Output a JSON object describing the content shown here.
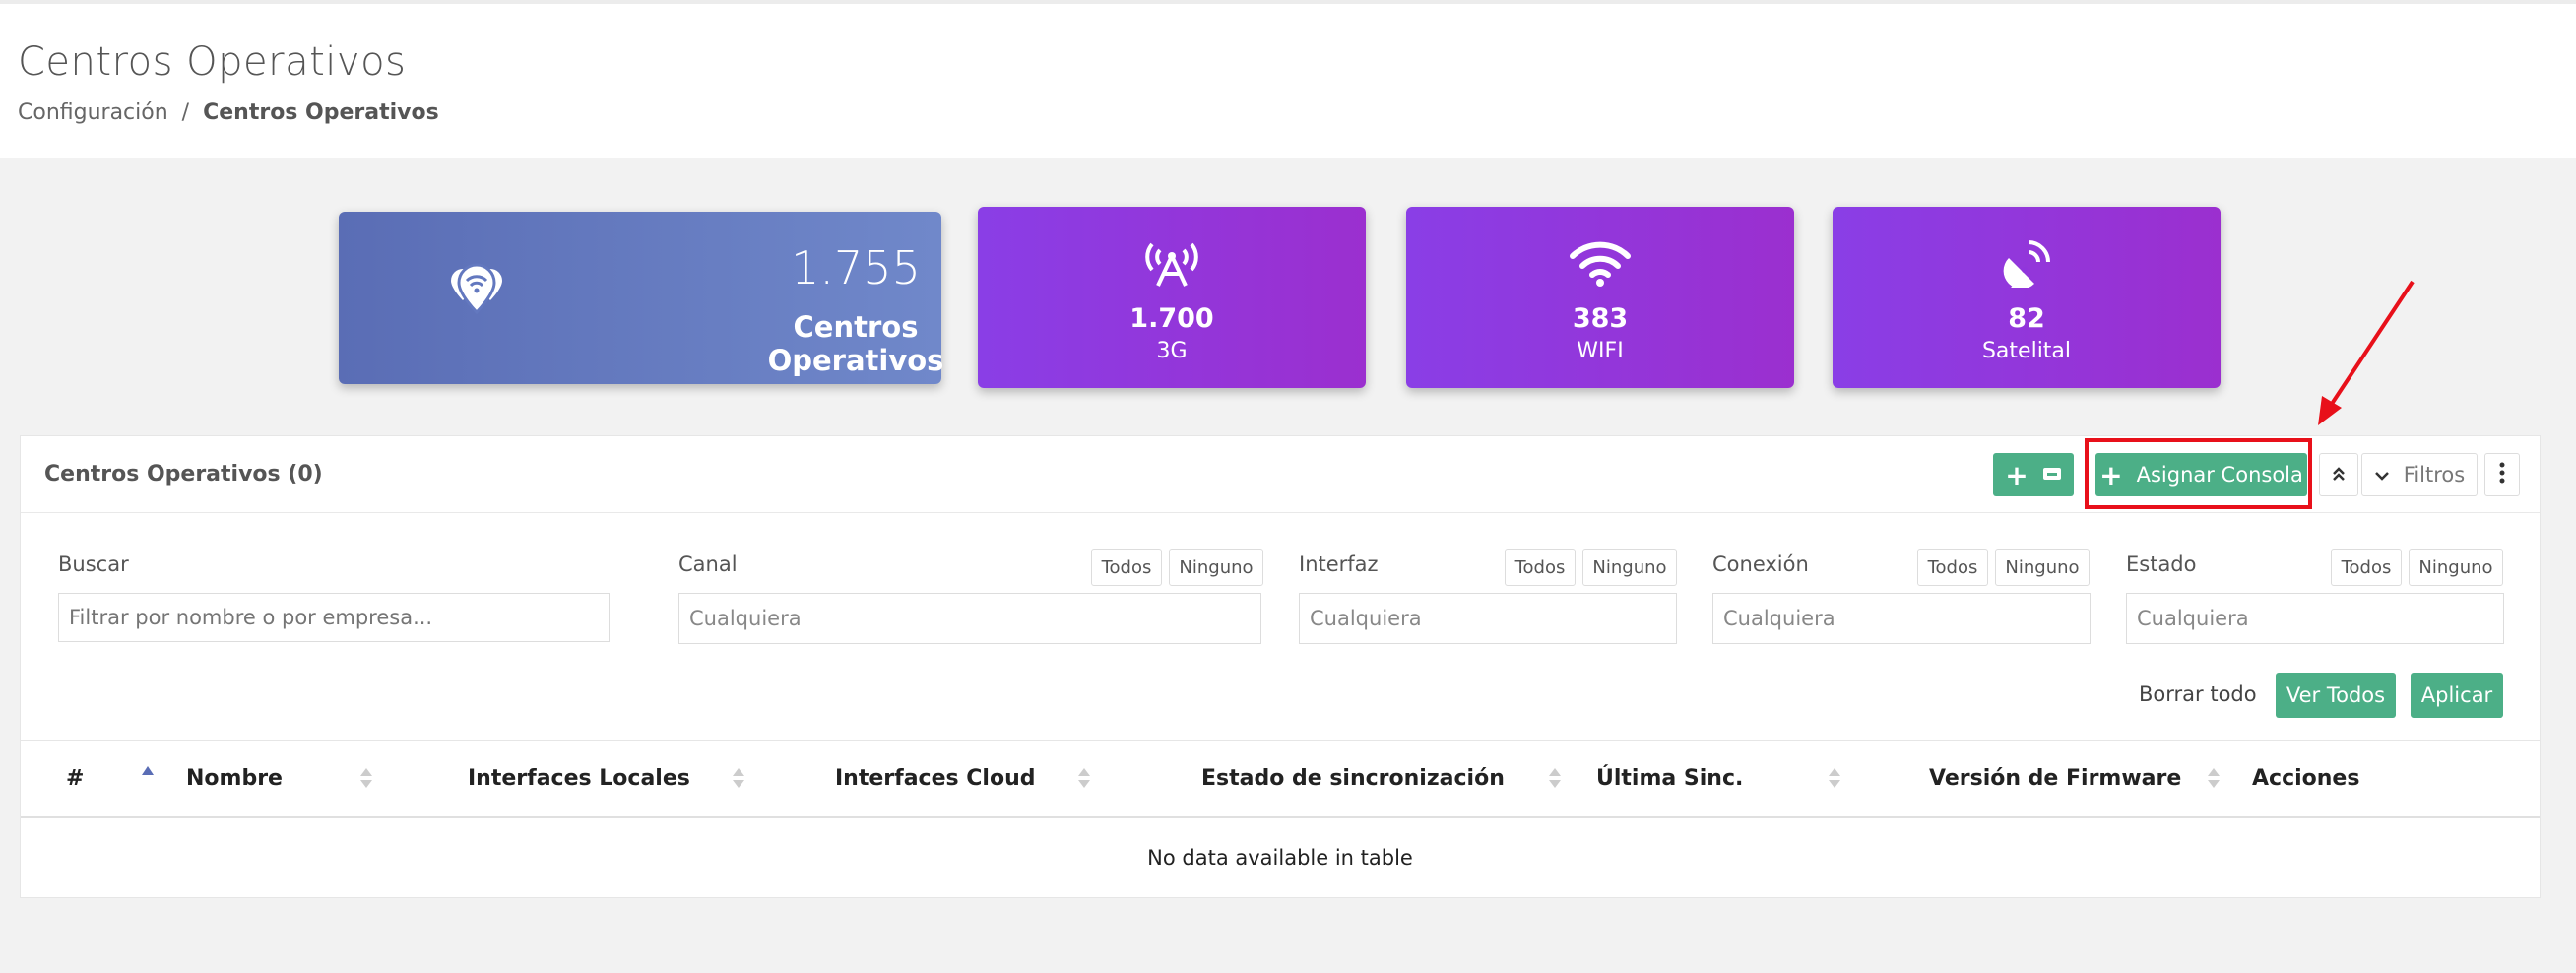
{
  "header": {
    "title": "Centros Operativos",
    "breadcrumb": [
      "Configuración",
      "/",
      "Centros Operativos"
    ]
  },
  "stats": {
    "main": {
      "value": "1.755",
      "label": "Centros Operativos",
      "icon": "location-wifi-icon"
    },
    "cards": [
      {
        "value": "1.700",
        "label": "3G",
        "icon": "antenna-icon"
      },
      {
        "value": "383",
        "label": "WIFI",
        "icon": "wifi-icon"
      },
      {
        "value": "82",
        "label": "Satelital",
        "icon": "satellite-dish-icon"
      }
    ]
  },
  "panel": {
    "title": "Centros Operativos (0)",
    "buttons": {
      "add": "+",
      "assign_console": "Asignar Consola",
      "filters": "Filtros"
    }
  },
  "filters": {
    "search": {
      "label": "Buscar",
      "placeholder": "Filtrar por nombre o por empresa..."
    },
    "canal": {
      "label": "Canal",
      "value": "Cualquiera"
    },
    "interfaz": {
      "label": "Interfaz",
      "value": "Cualquiera"
    },
    "conexion": {
      "label": "Conexión",
      "value": "Cualquiera"
    },
    "estado": {
      "label": "Estado",
      "value": "Cualquiera"
    },
    "todos": "Todos",
    "ninguno": "Ninguno",
    "clear_all": "Borrar todo",
    "view_all": "Ver Todos",
    "apply": "Aplicar"
  },
  "table": {
    "columns": [
      "#",
      "Nombre",
      "Interfaces Locales",
      "Interfaces Cloud",
      "Estado de sincronización",
      "Última Sinc.",
      "Versión de Firmware",
      "Acciones"
    ],
    "empty_text": "No data available in table"
  },
  "colors": {
    "accent_green": "#4caf87",
    "card_blue": "#6378bf",
    "card_purple": "#9035dc",
    "highlight_red": "#e8101a"
  }
}
